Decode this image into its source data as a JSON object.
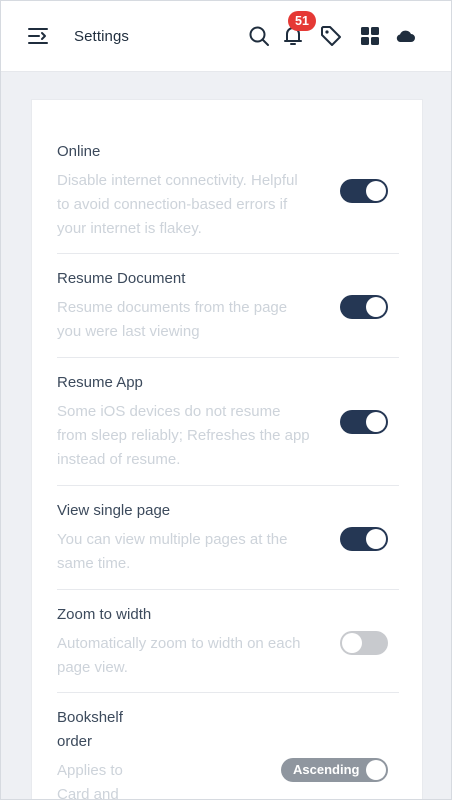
{
  "header": {
    "title": "Settings",
    "notification_count": "51",
    "icons": [
      "menu-icon",
      "search-icon",
      "bell-icon",
      "tag-icon",
      "grid-icon",
      "cloud-icon"
    ]
  },
  "colors": {
    "accent": "#253754",
    "toggle_off": "#c8cace",
    "badge": "#e53935",
    "title_text": "#3c4a5c",
    "desc_text": "#cdd3da"
  },
  "settings": {
    "online": {
      "title": "Online",
      "desc_lines": [
        "Disable internet connectivity. Helpful",
        "to avoid connection-based errors if",
        "your internet is flakey."
      ],
      "enabled": true
    },
    "resume_document": {
      "title": "Resume Document",
      "desc_lines": [
        "Resume documents from the page",
        "you were last viewing"
      ],
      "enabled": true
    },
    "resume_app": {
      "title": "Resume App",
      "desc_lines": [
        "Some iOS devices do not resume",
        "from sleep reliably; Refreshes the app",
        "instead of resume."
      ],
      "enabled": true
    },
    "view_single_page": {
      "title": "View single page",
      "desc_lines": [
        "You can view multiple pages at the",
        "same time."
      ],
      "enabled": true
    },
    "zoom_to_width": {
      "title": "Zoom to width",
      "desc_lines": [
        "Automatically zoom to width on each",
        "page view."
      ],
      "enabled": false
    },
    "bookshelf_order": {
      "title_lines": [
        "Bookshelf",
        "order"
      ],
      "desc_lines": [
        "Applies to",
        "Card and"
      ],
      "value": "Ascending"
    }
  }
}
